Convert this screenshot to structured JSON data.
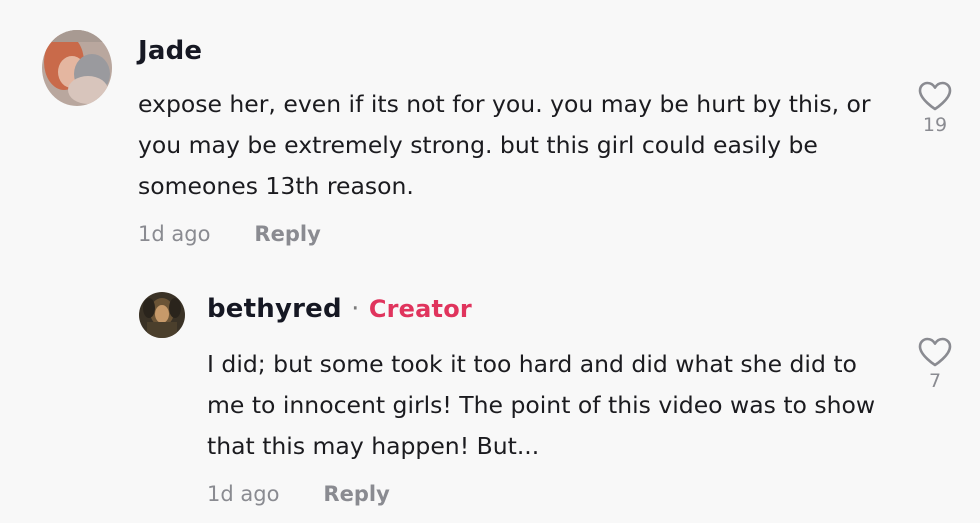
{
  "comments": [
    {
      "username": "Jade",
      "text": "expose her, even if its not for you. you may be hurt by this, or you may be extremely strong. but this girl could easily be someones 13th reason.",
      "time": "1d ago",
      "reply_label": "Reply",
      "like_count": "19",
      "like_icon": "heart-outline-icon"
    },
    {
      "username": "bethyred",
      "separator": "·",
      "creator_label": "Creator",
      "text": "I did; but some took it too hard and did what she did to me to innocent girls! The point of this video was to show that this may happen! But...",
      "time": "1d ago",
      "reply_label": "Reply",
      "like_count": "7",
      "like_icon": "heart-outline-icon"
    }
  ],
  "colors": {
    "background": "#f8f8f8",
    "creator": "#e0345d",
    "meta": "#8a8b91"
  }
}
